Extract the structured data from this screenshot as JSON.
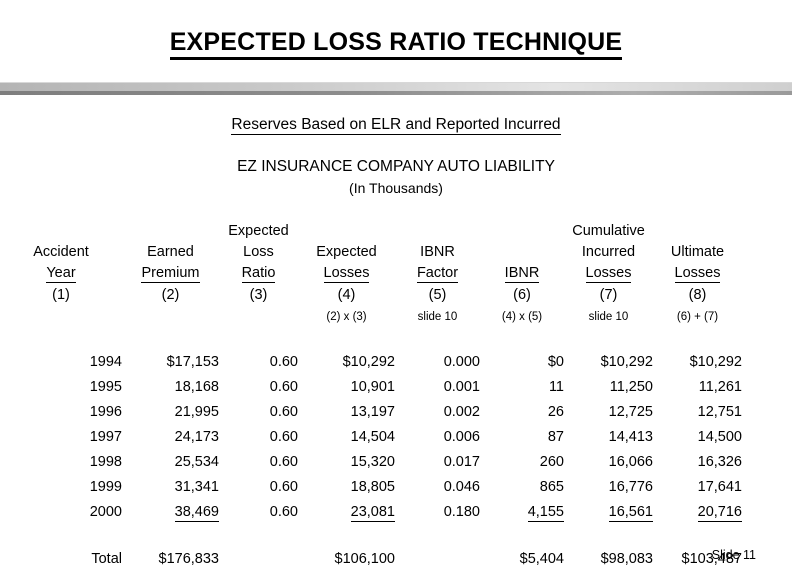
{
  "slide": {
    "title": "EXPECTED LOSS RATIO TECHNIQUE",
    "subtitle_reserves": "Reserves Based on ELR and Reported Incurred",
    "subtitle_company": "EZ INSURANCE  COMPANY AUTO  LIABILITY",
    "subtitle_units": "(In Thousands)",
    "slide_number": "Slide 11"
  },
  "table": {
    "headers_line1": [
      "",
      "",
      "Expected",
      "",
      "",
      "",
      "Cumulative",
      ""
    ],
    "headers_line2": [
      "Accident",
      "Earned",
      "Loss",
      "Expected",
      "IBNR",
      "",
      "Incurred",
      "Ultimate"
    ],
    "headers_line3": [
      "Year",
      "Premium",
      "Ratio",
      "Losses",
      "Factor",
      "IBNR",
      "Losses",
      "Losses"
    ],
    "headers_numbers": [
      "(1)",
      "(2)",
      "(3)",
      "(4)",
      "(5)",
      "(6)",
      "(7)",
      "(8)"
    ],
    "headers_notes": [
      "",
      "",
      "",
      "(2) x (3)",
      "slide 10",
      "(4) x (5)",
      "slide 10",
      "(6) + (7)"
    ],
    "rows": [
      {
        "year": "1994",
        "earned_premium": "$17,153",
        "elr": "0.60",
        "expected_losses": "$10,292",
        "ibnr_factor": "0.000",
        "ibnr": "$0",
        "cumulative_incurred": "$10,292",
        "ultimate_losses": "$10,292"
      },
      {
        "year": "1995",
        "earned_premium": "18,168",
        "elr": "0.60",
        "expected_losses": "10,901",
        "ibnr_factor": "0.001",
        "ibnr": "11",
        "cumulative_incurred": "11,250",
        "ultimate_losses": "11,261"
      },
      {
        "year": "1996",
        "earned_premium": "21,995",
        "elr": "0.60",
        "expected_losses": "13,197",
        "ibnr_factor": "0.002",
        "ibnr": "26",
        "cumulative_incurred": "12,725",
        "ultimate_losses": "12,751"
      },
      {
        "year": "1997",
        "earned_premium": "24,173",
        "elr": "0.60",
        "expected_losses": "14,504",
        "ibnr_factor": "0.006",
        "ibnr": "87",
        "cumulative_incurred": "14,413",
        "ultimate_losses": "14,500"
      },
      {
        "year": "1998",
        "earned_premium": "25,534",
        "elr": "0.60",
        "expected_losses": "15,320",
        "ibnr_factor": "0.017",
        "ibnr": "260",
        "cumulative_incurred": "16,066",
        "ultimate_losses": "16,326"
      },
      {
        "year": "1999",
        "earned_premium": "31,341",
        "elr": "0.60",
        "expected_losses": "18,805",
        "ibnr_factor": "0.046",
        "ibnr": "865",
        "cumulative_incurred": "16,776",
        "ultimate_losses": "17,641"
      },
      {
        "year": "2000",
        "earned_premium": "38,469",
        "elr": "0.60",
        "expected_losses": "23,081",
        "ibnr_factor": "0.180",
        "ibnr": "4,155",
        "cumulative_incurred": "16,561",
        "ultimate_losses": "20,716"
      }
    ],
    "total": {
      "label": "Total",
      "earned_premium": "$176,833",
      "elr": "",
      "expected_losses": "$106,100",
      "ibnr_factor": "",
      "ibnr": "$5,404",
      "cumulative_incurred": "$98,083",
      "ultimate_losses": "$103,487"
    }
  }
}
